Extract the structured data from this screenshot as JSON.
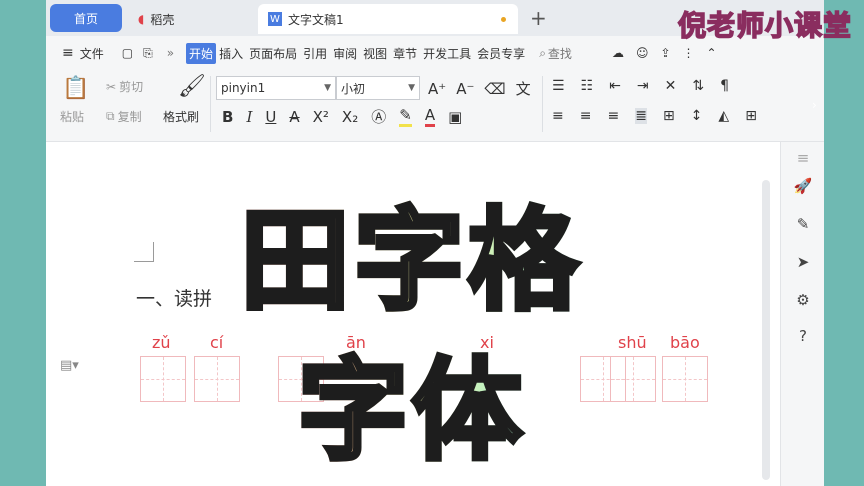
{
  "tabs": {
    "home": "首页",
    "daoke": "稻壳",
    "doc": "文字文稿1",
    "new": "+"
  },
  "menu": {
    "file": "文件",
    "items": [
      "开始",
      "插入",
      "页面布局",
      "引用",
      "审阅",
      "视图",
      "章节",
      "开发工具",
      "会员专享"
    ],
    "search": "查找"
  },
  "ribbon": {
    "paste": "粘贴",
    "cut": "剪切",
    "copy": "复制",
    "format_painter": "格式刷",
    "font_name": "pinyin1",
    "font_size": "小初",
    "bold": "B",
    "italic": "I",
    "underline": "U",
    "superscript": "X²",
    "subscript": "X₂"
  },
  "document": {
    "heading": "一、读拼",
    "pinyin": [
      "zǔ",
      "cí",
      "ān",
      "xi",
      "shū",
      "bāo"
    ]
  },
  "overlay": {
    "line1": "田字格",
    "line2": "字体"
  },
  "watermark": "倪老师小课堂",
  "colors": {
    "accent": "#4a7ce0",
    "pinyin": "#e0424a",
    "grid": "#f0b9bc"
  }
}
